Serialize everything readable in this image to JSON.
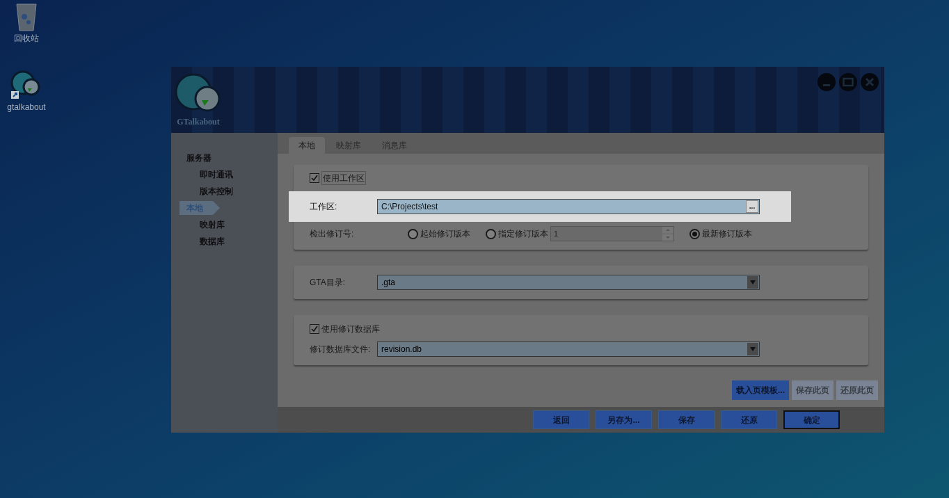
{
  "desktop_icons": [
    {
      "kind": "recycle",
      "label": "回收站"
    },
    {
      "kind": "app",
      "label": "gtalkabout"
    }
  ],
  "window": {
    "logo_text": "GTalkabout"
  },
  "sidebar": {
    "items": [
      {
        "label": "服务器",
        "selected": false,
        "children": [
          {
            "label": "即时通讯",
            "selected": false
          },
          {
            "label": "版本控制",
            "selected": false
          }
        ]
      },
      {
        "label": "本地",
        "selected": true,
        "children": [
          {
            "label": "映射库",
            "selected": false
          },
          {
            "label": "数据库",
            "selected": false
          }
        ]
      }
    ]
  },
  "tabs": [
    {
      "label": "本地",
      "selected": true
    },
    {
      "label": "映射库",
      "selected": false
    },
    {
      "label": "消息库",
      "selected": false
    }
  ],
  "workspace_group": {
    "use_checkbox": {
      "label": "使用工作区",
      "checked": true
    },
    "label": "工作区:",
    "value": "C:\\Projects\\test",
    "browse_button": "...",
    "revision_label": "检出修订号:",
    "revision_options": [
      {
        "label": "起始修订版本",
        "selected": false,
        "kind": "plain"
      },
      {
        "label": "指定修订版本",
        "selected": false,
        "kind": "spinner",
        "spinner_value": "1"
      },
      {
        "label": "最新修订版本",
        "selected": true,
        "kind": "plain"
      }
    ]
  },
  "gta_group": {
    "label": "GTA目录:",
    "value": ".gta"
  },
  "db_group": {
    "use_checkbox": {
      "label": "使用修订数据库",
      "checked": true
    },
    "label": "修订数据库文件:",
    "value": "revision.db"
  },
  "page_buttons": [
    {
      "label": "载入页模板...",
      "disabled": false
    },
    {
      "label": "保存此页",
      "disabled": true
    },
    {
      "label": "还原此页",
      "disabled": true
    }
  ],
  "footer_buttons": [
    {
      "label": "返回",
      "default": false
    },
    {
      "label": "另存为...",
      "default": false
    },
    {
      "label": "保存",
      "default": false
    },
    {
      "label": "还原",
      "default": false
    },
    {
      "label": "确定",
      "default": true
    }
  ]
}
